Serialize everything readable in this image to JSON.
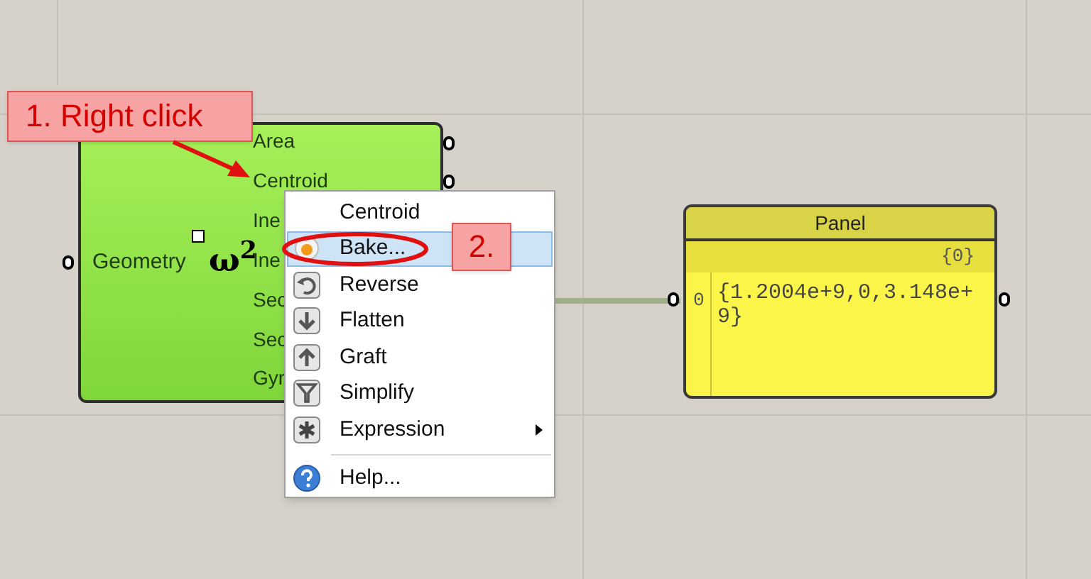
{
  "annotations": [
    {
      "text": "1. Right click"
    },
    {
      "text": "2."
    }
  ],
  "component": {
    "input": "Geometry",
    "icon_label": "ω$^{2}$",
    "outputs": [
      "Area",
      "Centroid",
      "Ine",
      "Ine",
      "Sec",
      "Sec",
      "Gyr"
    ]
  },
  "context_menu": {
    "items": [
      {
        "kind": "title",
        "label": "Centroid",
        "selected": false,
        "submenu": false
      },
      {
        "kind": "bake",
        "label": "Bake...",
        "selected": true,
        "submenu": false
      },
      {
        "kind": "reverse",
        "label": "Reverse",
        "selected": false,
        "submenu": false
      },
      {
        "kind": "flatten",
        "label": "Flatten",
        "selected": false,
        "submenu": false
      },
      {
        "kind": "graft",
        "label": "Graft",
        "selected": false,
        "submenu": false
      },
      {
        "kind": "simplify",
        "label": "Simplify",
        "selected": false,
        "submenu": false
      },
      {
        "kind": "expression",
        "label": "Expression",
        "selected": false,
        "submenu": true
      },
      {
        "kind": "separator"
      },
      {
        "kind": "help",
        "label": "Help...",
        "selected": false,
        "submenu": false
      }
    ]
  },
  "panel": {
    "title": "Panel",
    "path": "{0}",
    "index": "0",
    "value": "{1.2004e+9,0,3.148e+9}"
  }
}
